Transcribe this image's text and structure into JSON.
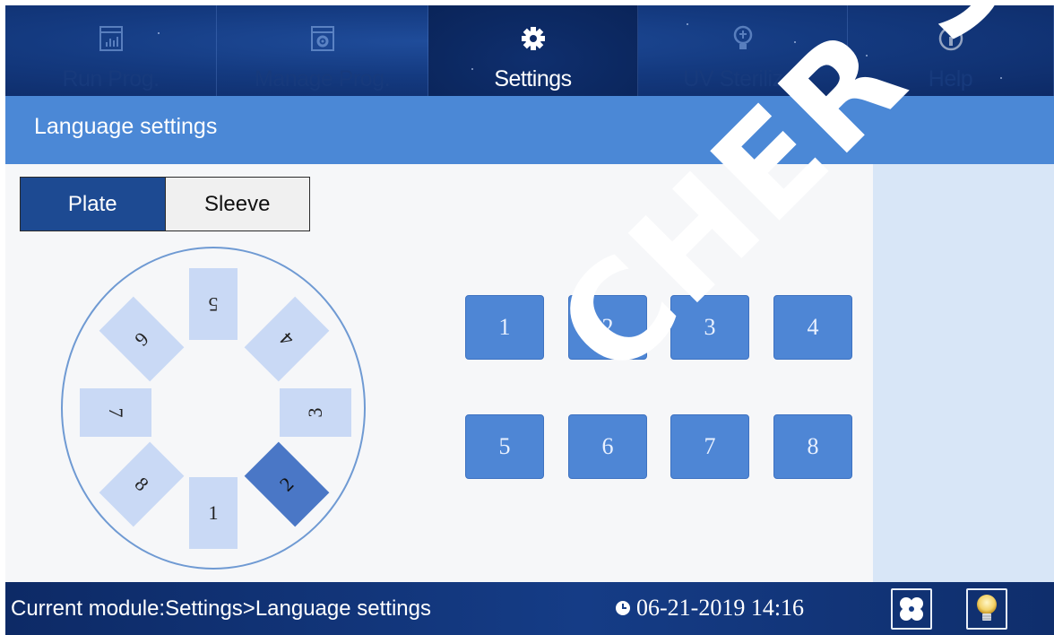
{
  "nav": {
    "tabs": [
      {
        "label": "Run Prog.",
        "icon": "bar-chart-icon",
        "active": false
      },
      {
        "label": "Manage Prog.",
        "icon": "gear-doc-icon",
        "active": false
      },
      {
        "label": "Settings",
        "icon": "gear-icon",
        "active": true
      },
      {
        "label": "UV Sterilizer",
        "icon": "lightbulb-icon",
        "active": false
      },
      {
        "label": "Help",
        "icon": "info-icon",
        "active": false
      }
    ]
  },
  "section": {
    "title": "Language settings"
  },
  "toggle": {
    "plate": "Plate",
    "sleeve": "Sleeve",
    "selected": "Plate"
  },
  "wheel": {
    "slots": [
      "1",
      "2",
      "3",
      "4",
      "5",
      "6",
      "7",
      "8"
    ],
    "selected": "2"
  },
  "grid": {
    "buttons": [
      "1",
      "2",
      "3",
      "4",
      "5",
      "6",
      "7",
      "8"
    ]
  },
  "status": {
    "module_text": "Current module:Settings>Language settings",
    "datetime": "06-21-2019 14:16",
    "fan_icon": "fan-icon",
    "light_icon": "lightbulb-icon"
  },
  "watermark": "CHER SA",
  "colors": {
    "nav_bg": "#143a80",
    "header_bg": "#4b88d6",
    "button_bg": "#4e86d5",
    "slot_bg": "#c9d9f5",
    "slot_selected": "#4a77c6",
    "toggle_on": "#1d4a92"
  }
}
